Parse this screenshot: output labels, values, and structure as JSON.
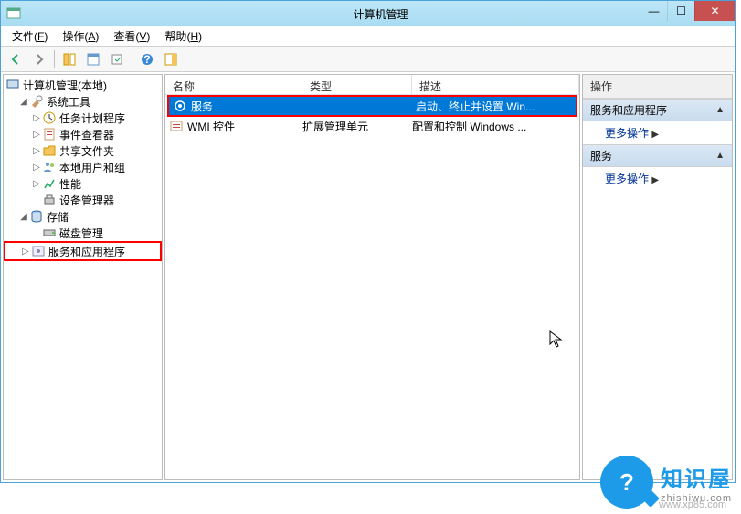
{
  "titlebar": {
    "title": "计算机管理"
  },
  "menu": {
    "file": "文件",
    "file_u": "F",
    "action": "操作",
    "action_u": "A",
    "view": "查看",
    "view_u": "V",
    "help": "帮助",
    "help_u": "H"
  },
  "tree": {
    "root": "计算机管理(本地)",
    "systools": "系统工具",
    "taskscheduler": "任务计划程序",
    "eventviewer": "事件查看器",
    "sharedfolders": "共享文件夹",
    "localusers": "本地用户和组",
    "performance": "性能",
    "devicemgr": "设备管理器",
    "storage": "存储",
    "diskmgmt": "磁盘管理",
    "servicesapps": "服务和应用程序"
  },
  "list": {
    "headers": {
      "name": "名称",
      "type": "类型",
      "desc": "描述"
    },
    "rows": [
      {
        "name": "服务",
        "type": "",
        "desc": "启动、终止并设置 Win..."
      },
      {
        "name": "WMI 控件",
        "type": "扩展管理单元",
        "desc": "配置和控制 Windows ..."
      }
    ]
  },
  "actions": {
    "header": "操作",
    "group1": "服务和应用程序",
    "more1": "更多操作",
    "group2": "服务",
    "more2": "更多操作"
  },
  "watermark": {
    "title": "知识屋",
    "url": "zhishiwu.com",
    "url2": "www.xp85.com"
  }
}
